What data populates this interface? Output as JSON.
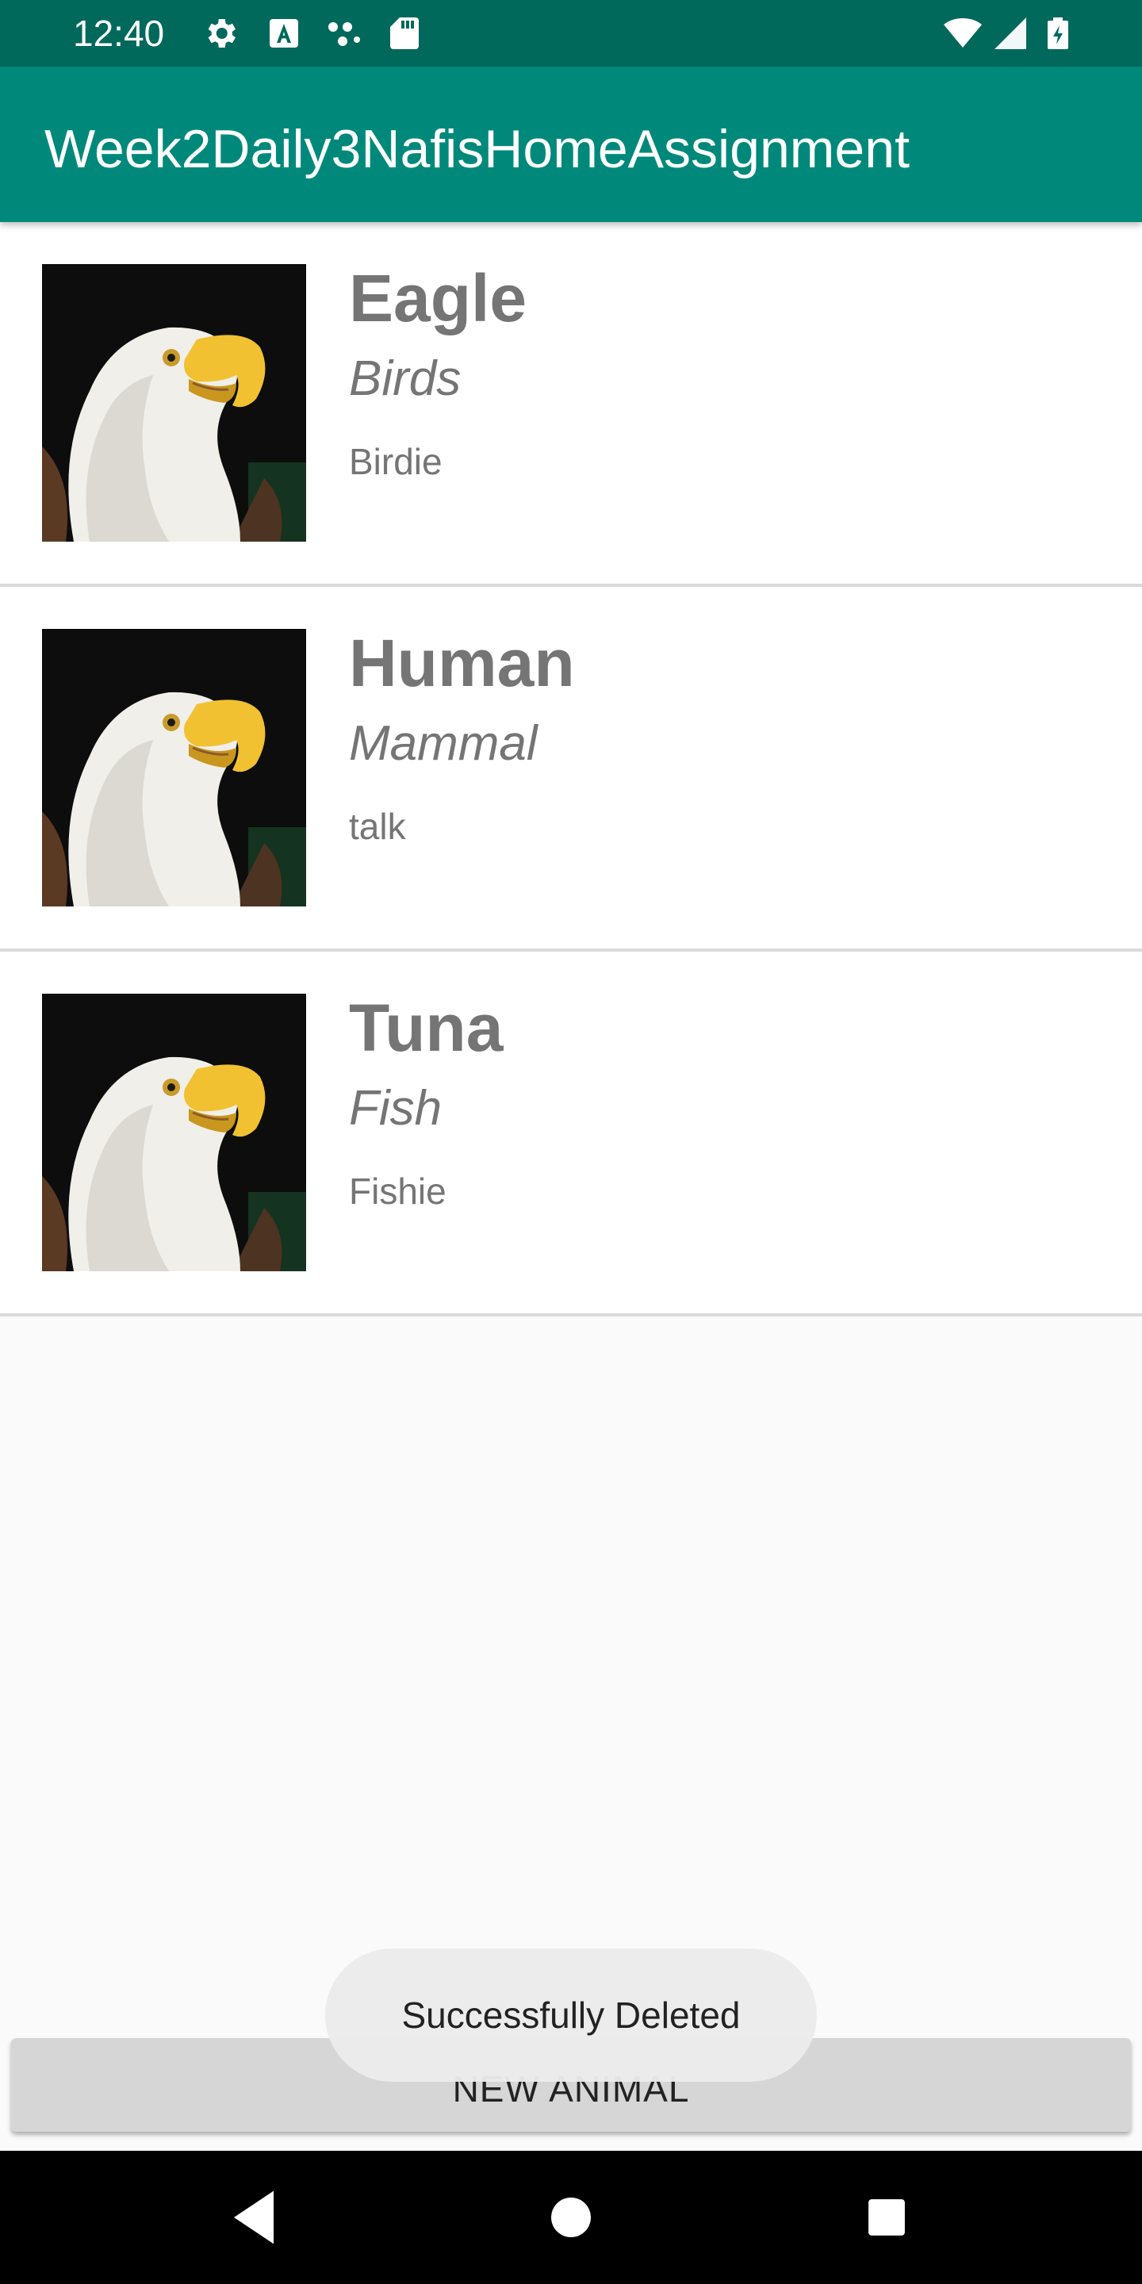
{
  "status_bar": {
    "time": "12:40",
    "icons_left": [
      "gear-icon",
      "a-box-icon",
      "dots-icon",
      "sd-card-icon"
    ],
    "icons_right": [
      "wifi-icon",
      "signal-icon",
      "battery-charging-icon"
    ]
  },
  "app_bar": {
    "title": "Week2Daily3NafisHomeAssignment",
    "color": "#00897b",
    "status_color": "#00695c"
  },
  "animals": [
    {
      "name": "Eagle",
      "type": "Birds",
      "sound": "Birdie",
      "image_icon": "eagle-image"
    },
    {
      "name": "Human",
      "type": "Mammal",
      "sound": "talk",
      "image_icon": "eagle-image"
    },
    {
      "name": "Tuna",
      "type": "Fish",
      "sound": "Fishie",
      "image_icon": "eagle-image"
    }
  ],
  "button": {
    "label": "NEW ANIMAL"
  },
  "toast": {
    "message": "Successfully Deleted"
  },
  "nav_bar": {
    "icons": [
      "back-icon",
      "home-icon",
      "recents-icon"
    ]
  }
}
